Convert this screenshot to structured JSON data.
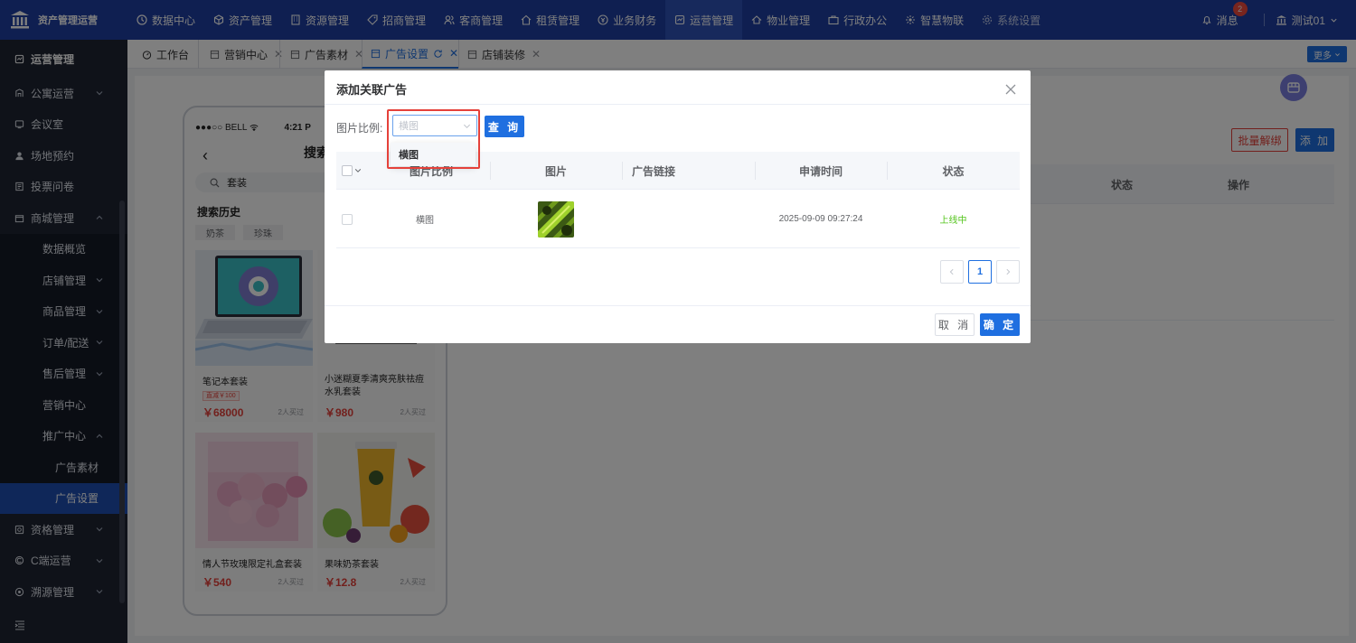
{
  "app": {
    "title": "资产管理运营"
  },
  "topnav": {
    "items": [
      {
        "label": "数据中心",
        "icon": "clock-icon"
      },
      {
        "label": "资产管理",
        "icon": "cube-icon"
      },
      {
        "label": "资源管理",
        "icon": "building-icon"
      },
      {
        "label": "招商管理",
        "icon": "tag-icon"
      },
      {
        "label": "客商管理",
        "icon": "users-icon"
      },
      {
        "label": "租赁管理",
        "icon": "house-icon"
      },
      {
        "label": "业务财务",
        "icon": "coin-icon"
      },
      {
        "label": "运营管理",
        "icon": "operations-icon",
        "active": true
      },
      {
        "label": "物业管理",
        "icon": "home-icon"
      },
      {
        "label": "行政办公",
        "icon": "briefcase-icon"
      },
      {
        "label": "智慧物联",
        "icon": "iot-icon"
      },
      {
        "label": "系统设置",
        "icon": "gear-icon"
      }
    ],
    "messages_label": "消息",
    "messages_count": "2",
    "user_label": "测试01"
  },
  "sidebar": {
    "header": "运营管理",
    "items": [
      {
        "label": "公寓运营",
        "level": 0,
        "chevron": "down"
      },
      {
        "label": "会议室",
        "level": 0
      },
      {
        "label": "场地预约",
        "level": 0
      },
      {
        "label": "投票问卷",
        "level": 0
      },
      {
        "label": "商城管理",
        "level": 0,
        "chevron": "up"
      },
      {
        "label": "数据概览",
        "level": 1
      },
      {
        "label": "店铺管理",
        "level": 1,
        "chevron": "down"
      },
      {
        "label": "商品管理",
        "level": 1,
        "chevron": "down"
      },
      {
        "label": "订单/配送",
        "level": 1,
        "chevron": "down"
      },
      {
        "label": "售后管理",
        "level": 1,
        "chevron": "down"
      },
      {
        "label": "营销中心",
        "level": 1
      },
      {
        "label": "推广中心",
        "level": 1,
        "chevron": "up"
      },
      {
        "label": "广告素材",
        "level": 2
      },
      {
        "label": "广告设置",
        "level": 2,
        "active": true
      },
      {
        "label": "资格管理",
        "level": 0,
        "chevron": "down"
      },
      {
        "label": "C端运营",
        "level": 0,
        "chevron": "down"
      },
      {
        "label": "溯源管理",
        "level": 0,
        "chevron": "down"
      }
    ]
  },
  "tabs": {
    "items": [
      {
        "label": "工作台"
      },
      {
        "label": "营销中心"
      },
      {
        "label": "广告素材"
      },
      {
        "label": "广告设置",
        "active": true
      },
      {
        "label": "店铺装修"
      }
    ],
    "more_label": "更多"
  },
  "page": {
    "unbind_label": "批量解绑",
    "add_label": "添 加",
    "table_headers": [
      "状态",
      "操作"
    ]
  },
  "phone": {
    "carrier": "●●●○○ BELL",
    "time": "4:21 P",
    "title": "搜索",
    "search_value": "套装",
    "history_title": "搜索历史",
    "history_tags": [
      "奶茶",
      "珍珠"
    ],
    "products": [
      {
        "name": "笔记本套装",
        "promo": "直减￥100",
        "price": "￥68000",
        "bought": "2人买过"
      },
      {
        "name": "小迷糊夏季清爽亮肤祛痘水乳套装",
        "price": "￥980",
        "bought": "2人买过"
      },
      {
        "name": "情人节玫瑰限定礼盒套装",
        "price": "￥540",
        "bought": "2人买过"
      },
      {
        "name": "果味奶茶套装",
        "price": "￥12.8",
        "bought": "2人买过"
      }
    ]
  },
  "modal": {
    "title": "添加关联广告",
    "filter_label": "图片比例:",
    "select_placeholder": "横图",
    "dropdown_options": [
      "横图"
    ],
    "query_label": "查 询",
    "columns": [
      "图片比例",
      "图片",
      "广告链接",
      "申请时间",
      "状态"
    ],
    "rows": [
      {
        "ratio": "横图",
        "link": "",
        "time": "2025-09-09 09:27:24",
        "status": "上线中"
      }
    ],
    "pagination": {
      "current": "1"
    },
    "cancel_label": "取 消",
    "ok_label": "确 定"
  },
  "colors": {
    "primary": "#1f6fe0",
    "topbar": "#1f3fa2",
    "sidebar": "#1e2433",
    "danger": "#e5413a",
    "success": "#52c41a"
  }
}
